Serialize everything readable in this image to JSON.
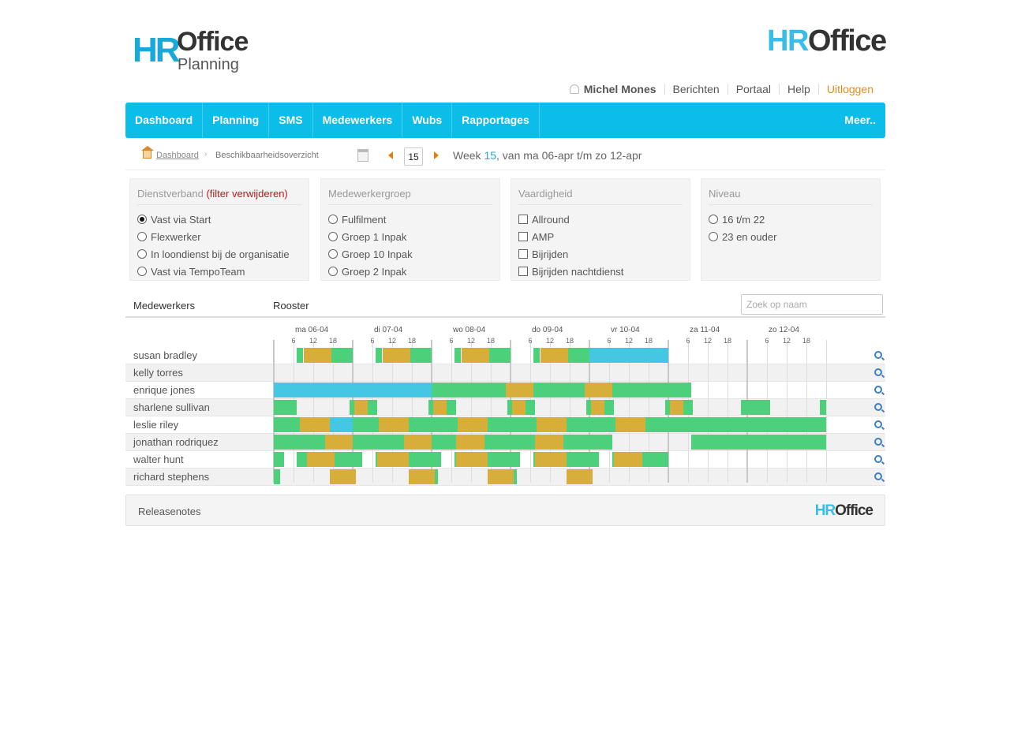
{
  "brand": {
    "hr_text": "HR",
    "office_text": "Office",
    "planning_text": "Planning",
    "accent": "#0bbde8"
  },
  "user_links": {
    "user_name": "Michel Mones",
    "messages": "Berichten",
    "portal": "Portaal",
    "help": "Help",
    "logout": "Uitloggen"
  },
  "nav": {
    "items": [
      "Dashboard",
      "Planning",
      "SMS",
      "Medewerkers",
      "Wubs",
      "Rapportages"
    ],
    "more": "Meer.."
  },
  "breadcrumb": {
    "home": "Dashboard",
    "current": "Beschikbaarheidsoverzicht"
  },
  "week": {
    "number": "15",
    "prefix": "Week ",
    "highlight": "15",
    "suffix": ", van ma 06-apr t/m zo 12-apr"
  },
  "filters": [
    {
      "title": "Dienstverband",
      "remove": "(filter verwijderen)",
      "kind": "radio",
      "options": [
        {
          "label": "Vast via Start",
          "checked": true
        },
        {
          "label": "Flexwerker",
          "checked": false
        },
        {
          "label": "In loondienst bij de organisatie",
          "checked": false
        },
        {
          "label": "Vast via TempoTeam",
          "checked": false
        }
      ]
    },
    {
      "title": "Medewerkergroep",
      "remove": "",
      "kind": "radio",
      "options": [
        {
          "label": "Fulfilment",
          "checked": false
        },
        {
          "label": "Groep 1 Inpak",
          "checked": false
        },
        {
          "label": "Groep 10 Inpak",
          "checked": false
        },
        {
          "label": "Groep 2 Inpak",
          "checked": false
        }
      ]
    },
    {
      "title": "Vaardigheid",
      "remove": "",
      "kind": "checkbox",
      "options": [
        {
          "label": "Allround",
          "checked": false
        },
        {
          "label": "AMP",
          "checked": false
        },
        {
          "label": "Bijrijden",
          "checked": false
        },
        {
          "label": "Bijrijden nachtdienst",
          "checked": false
        }
      ]
    },
    {
      "title": "Niveau",
      "remove": "",
      "kind": "radio",
      "options": [
        {
          "label": "16 t/m 22",
          "checked": false
        },
        {
          "label": "23 en ouder",
          "checked": false
        }
      ]
    }
  ],
  "schedule": {
    "col_employees": "Medewerkers",
    "col_roster": "Rooster",
    "search_placeholder": "Zoek op naam",
    "days": [
      "ma 06-04",
      "di 07-04",
      "wo 08-04",
      "do 09-04",
      "vr 10-04",
      "za 11-04",
      "zo 12-04"
    ],
    "hour_ticks": [
      "6",
      "12",
      "18"
    ],
    "colors": {
      "available": "#4cd07c",
      "scheduled": "#d8ae3a",
      "leave": "#45c6e2"
    },
    "rows": [
      {
        "name": "susan bradley",
        "bars": [
          {
            "t": "a",
            "s": 7,
            "e": 9
          },
          {
            "t": "s",
            "s": 9,
            "e": 17.5
          },
          {
            "t": "a",
            "s": 17.5,
            "e": 24
          },
          {
            "t": "a",
            "s": 31,
            "e": 33
          },
          {
            "t": "s",
            "s": 33,
            "e": 41.5
          },
          {
            "t": "a",
            "s": 41.5,
            "e": 48
          },
          {
            "t": "a",
            "s": 55,
            "e": 57
          },
          {
            "t": "s",
            "s": 57,
            "e": 65.5
          },
          {
            "t": "a",
            "s": 65.5,
            "e": 72
          },
          {
            "t": "a",
            "s": 79,
            "e": 81
          },
          {
            "t": "s",
            "s": 81,
            "e": 89.5
          },
          {
            "t": "a",
            "s": 89.5,
            "e": 96
          },
          {
            "t": "l",
            "s": 96,
            "e": 120
          }
        ]
      },
      {
        "name": "kelly torres",
        "bars": []
      },
      {
        "name": "enrique jones",
        "bars": [
          {
            "t": "l",
            "s": 0,
            "e": 48
          },
          {
            "t": "a",
            "s": 48,
            "e": 70.5
          },
          {
            "t": "s",
            "s": 70.5,
            "e": 79
          },
          {
            "t": "a",
            "s": 79,
            "e": 94.5
          },
          {
            "t": "s",
            "s": 94.5,
            "e": 103
          },
          {
            "t": "a",
            "s": 103,
            "e": 127
          }
        ]
      },
      {
        "name": "sharlene sullivan",
        "bars": [
          {
            "t": "a",
            "s": 0,
            "e": 7
          },
          {
            "t": "a",
            "s": 23,
            "e": 24.5
          },
          {
            "t": "s",
            "s": 24.5,
            "e": 28.5
          },
          {
            "t": "a",
            "s": 28.5,
            "e": 31.5
          },
          {
            "t": "a",
            "s": 47,
            "e": 48.5
          },
          {
            "t": "s",
            "s": 48.5,
            "e": 52.5
          },
          {
            "t": "a",
            "s": 52.5,
            "e": 55.5
          },
          {
            "t": "a",
            "s": 71,
            "e": 72.5
          },
          {
            "t": "s",
            "s": 72.5,
            "e": 76.5
          },
          {
            "t": "a",
            "s": 76.5,
            "e": 79.5
          },
          {
            "t": "a",
            "s": 95,
            "e": 96.5
          },
          {
            "t": "s",
            "s": 96.5,
            "e": 100.5
          },
          {
            "t": "a",
            "s": 100.5,
            "e": 103.5
          },
          {
            "t": "a",
            "s": 119,
            "e": 120.5
          },
          {
            "t": "s",
            "s": 120.5,
            "e": 124.5
          },
          {
            "t": "a",
            "s": 124.5,
            "e": 127.5
          },
          {
            "t": "a",
            "s": 142,
            "e": 151
          },
          {
            "t": "a",
            "s": 166,
            "e": 168
          }
        ]
      },
      {
        "name": "leslie riley",
        "bars": [
          {
            "t": "a",
            "s": 0,
            "e": 8
          },
          {
            "t": "s",
            "s": 8,
            "e": 17
          },
          {
            "t": "l",
            "s": 17,
            "e": 24
          },
          {
            "t": "a",
            "s": 24,
            "e": 32
          },
          {
            "t": "s",
            "s": 32,
            "e": 41
          },
          {
            "t": "a",
            "s": 41,
            "e": 56
          },
          {
            "t": "s",
            "s": 56,
            "e": 65
          },
          {
            "t": "a",
            "s": 65,
            "e": 80
          },
          {
            "t": "s",
            "s": 80,
            "e": 89
          },
          {
            "t": "a",
            "s": 89,
            "e": 104
          },
          {
            "t": "s",
            "s": 104,
            "e": 113
          },
          {
            "t": "a",
            "s": 113,
            "e": 168
          }
        ]
      },
      {
        "name": "jonathan rodriquez",
        "bars": [
          {
            "t": "a",
            "s": 0,
            "e": 15.5
          },
          {
            "t": "s",
            "s": 15.5,
            "e": 24
          },
          {
            "t": "a",
            "s": 24,
            "e": 39.5
          },
          {
            "t": "s",
            "s": 39.5,
            "e": 48
          },
          {
            "t": "a",
            "s": 48,
            "e": 55.5
          },
          {
            "t": "s",
            "s": 55.5,
            "e": 64
          },
          {
            "t": "a",
            "s": 64,
            "e": 79.5
          },
          {
            "t": "s",
            "s": 79.5,
            "e": 88
          },
          {
            "t": "a",
            "s": 88,
            "e": 103
          },
          {
            "t": "a",
            "s": 127,
            "e": 168
          }
        ]
      },
      {
        "name": "walter hunt",
        "bars": [
          {
            "t": "a",
            "s": 0,
            "e": 3
          },
          {
            "t": "a",
            "s": 7,
            "e": 10
          },
          {
            "t": "s",
            "s": 10,
            "e": 18.5
          },
          {
            "t": "a",
            "s": 18.5,
            "e": 27
          },
          {
            "t": "a",
            "s": 31,
            "e": 31.5
          },
          {
            "t": "s",
            "s": 31.5,
            "e": 41
          },
          {
            "t": "a",
            "s": 41,
            "e": 51
          },
          {
            "t": "a",
            "s": 55,
            "e": 55.5
          },
          {
            "t": "s",
            "s": 55.5,
            "e": 65
          },
          {
            "t": "a",
            "s": 65,
            "e": 75
          },
          {
            "t": "a",
            "s": 79,
            "e": 79.5
          },
          {
            "t": "s",
            "s": 79.5,
            "e": 89
          },
          {
            "t": "a",
            "s": 89,
            "e": 99
          },
          {
            "t": "a",
            "s": 103,
            "e": 103.5
          },
          {
            "t": "s",
            "s": 103.5,
            "e": 112
          },
          {
            "t": "a",
            "s": 112,
            "e": 120
          }
        ]
      },
      {
        "name": "richard stephens",
        "bars": [
          {
            "t": "a",
            "s": 0,
            "e": 2
          },
          {
            "t": "s",
            "s": 17,
            "e": 25
          },
          {
            "t": "s",
            "s": 41,
            "e": 49
          },
          {
            "t": "a",
            "s": 49,
            "e": 50
          },
          {
            "t": "s",
            "s": 65,
            "e": 73
          },
          {
            "t": "a",
            "s": 73,
            "e": 74
          },
          {
            "t": "s",
            "s": 89,
            "e": 97
          }
        ]
      }
    ]
  },
  "footer": {
    "releasenotes": "Releasenotes"
  }
}
